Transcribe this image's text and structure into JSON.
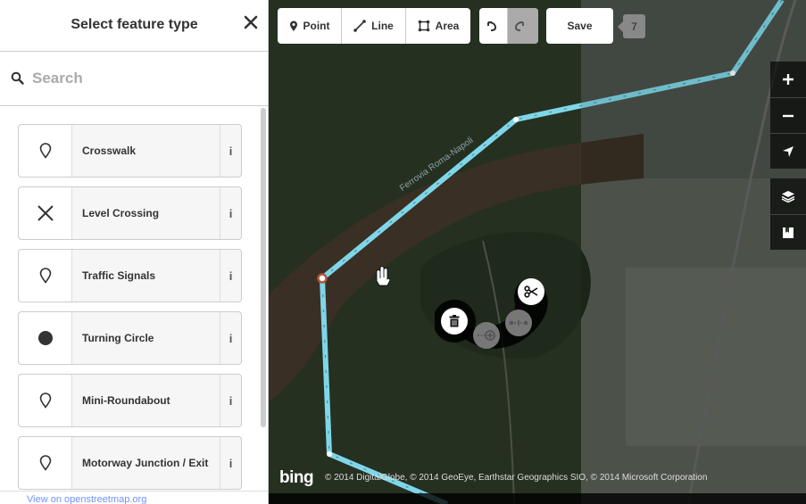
{
  "sidebar": {
    "title": "Select feature type",
    "search": {
      "placeholder": "Search",
      "value": ""
    },
    "presets": [
      {
        "label": "Crosswalk",
        "icon": "pin-icon"
      },
      {
        "label": "Level Crossing",
        "icon": "cross-icon"
      },
      {
        "label": "Traffic Signals",
        "icon": "pin-icon"
      },
      {
        "label": "Turning Circle",
        "icon": "circle-icon"
      },
      {
        "label": "Mini-Roundabout",
        "icon": "pin-icon"
      },
      {
        "label": "Motorway Junction / Exit",
        "icon": "pin-icon"
      }
    ],
    "info_label": "i",
    "footer_text": "View on openstreetmap.org"
  },
  "toolbar": {
    "point_label": "Point",
    "line_label": "Line",
    "area_label": "Area",
    "save_label": "Save",
    "save_count": "7"
  },
  "map": {
    "road_label": "Ferrovia Roma-Napoli",
    "logo": "bing",
    "attribution": "© 2014 DigitalGlobe, © 2014 GeoEye, Earthstar Geographics SIO, © 2014 Microsoft Corporation",
    "colors": {
      "way": "#7fd6e8",
      "accent": "#7092ff"
    }
  }
}
